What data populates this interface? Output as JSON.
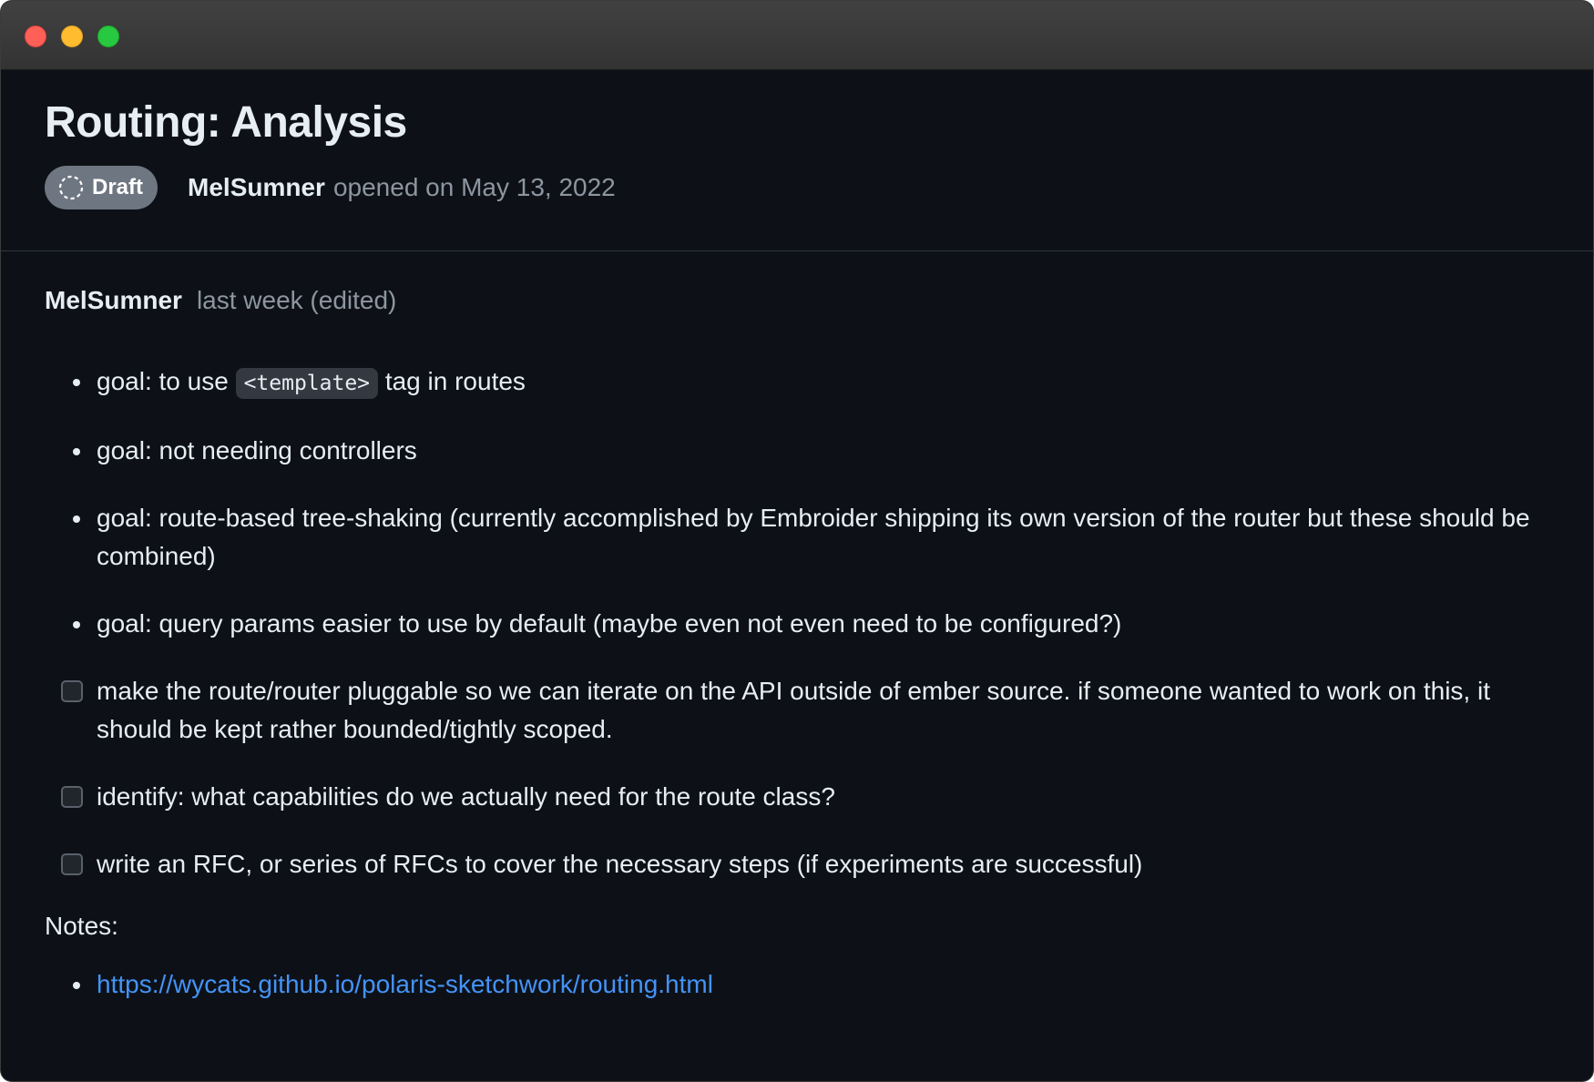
{
  "issue": {
    "title": "Routing: Analysis",
    "status": "Draft",
    "author": "MelSumner",
    "opened_text": "opened on May 13, 2022"
  },
  "comment": {
    "author": "MelSumner",
    "time": "last week (edited)",
    "goals": [
      {
        "before": "goal: to use ",
        "code": "<template>",
        "after": " tag in routes"
      },
      {
        "text": "goal: not needing controllers"
      },
      {
        "text": "goal: route-based tree-shaking (currently accomplished by Embroider shipping its own version of the router but these should be combined)"
      },
      {
        "text": "goal: query params easier to use by default (maybe even not even need to be configured?)"
      }
    ],
    "tasks": [
      {
        "text": "make the route/router pluggable so we can iterate on the API outside of ember source. if someone wanted to work on this, it should be kept rather bounded/tightly scoped.",
        "checked": false
      },
      {
        "text": "identify: what capabilities do we actually need for the route class?",
        "checked": false
      },
      {
        "text": "write an RFC, or series of RFCs to cover the necessary steps (if experiments are successful)",
        "checked": false
      }
    ],
    "notes_label": "Notes:",
    "links": [
      {
        "text": "https://wycats.github.io/polaris-sketchwork/routing.html"
      }
    ]
  },
  "colors": {
    "background": "#0d1117",
    "text": "#e6edf3",
    "muted": "#8d96a0",
    "link": "#4493f8",
    "badge": "#6e7681"
  },
  "icons": {
    "status": "draft-circle-icon"
  }
}
